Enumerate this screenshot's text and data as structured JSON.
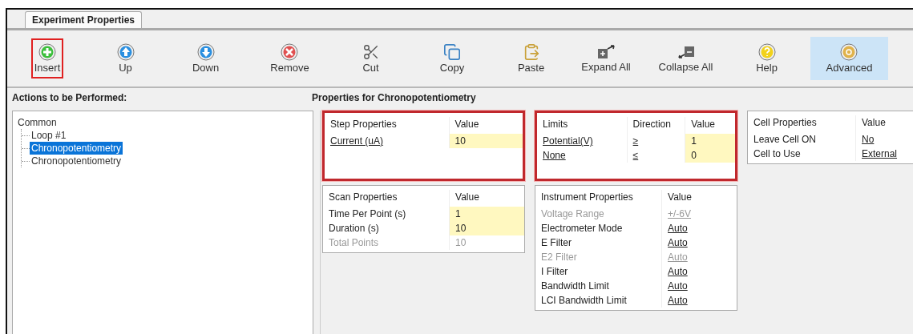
{
  "tabs": [
    {
      "label": "Experiment Properties",
      "selected": true
    }
  ],
  "toolbar": [
    {
      "label": "Insert",
      "kind": "insert",
      "selected": false,
      "annotated": true
    },
    {
      "label": "Up",
      "kind": "up",
      "selected": false,
      "annotated": false
    },
    {
      "label": "Down",
      "kind": "down",
      "selected": false,
      "annotated": false
    },
    {
      "label": "Remove",
      "kind": "remove",
      "selected": false,
      "annotated": false
    },
    {
      "label": "Cut",
      "kind": "cut",
      "selected": false,
      "annotated": false
    },
    {
      "label": "Copy",
      "kind": "copy",
      "selected": false,
      "annotated": false
    },
    {
      "label": "Paste",
      "kind": "paste",
      "selected": false,
      "annotated": false
    },
    {
      "label": "Expand All",
      "kind": "expand",
      "selected": false,
      "annotated": false
    },
    {
      "label": "Collapse All",
      "kind": "collapse",
      "selected": false,
      "annotated": false
    },
    {
      "label": "Help",
      "kind": "help",
      "selected": false,
      "annotated": false
    },
    {
      "label": "Advanced",
      "kind": "advanced",
      "selected": true,
      "annotated": false
    }
  ],
  "actions": {
    "title": "Actions to be Performed:",
    "tree": [
      {
        "label": "Common",
        "selected": false,
        "children": [
          {
            "label": "Loop #1",
            "selected": false
          },
          {
            "label": "Chronopotentiometry",
            "selected": true
          },
          {
            "label": "Chronopotentiometry",
            "selected": false
          }
        ]
      }
    ]
  },
  "properties": {
    "title": "Properties for Chronopotentiometry",
    "columns": [
      [
        {
          "annotated": true,
          "headers": [
            "Step Properties",
            "Value"
          ],
          "rows": [
            {
              "disabled": false,
              "cells": [
                {
                  "text": "Current (uA)",
                  "link": true,
                  "editable": false
                },
                {
                  "text": "10",
                  "link": false,
                  "editable": true
                }
              ]
            }
          ]
        },
        {
          "annotated": false,
          "headers": [
            "Scan Properties",
            "Value"
          ],
          "rows": [
            {
              "disabled": false,
              "cells": [
                {
                  "text": "Time Per Point (s)",
                  "link": false,
                  "editable": false
                },
                {
                  "text": "1",
                  "link": false,
                  "editable": true
                }
              ]
            },
            {
              "disabled": false,
              "cells": [
                {
                  "text": "Duration (s)",
                  "link": false,
                  "editable": false
                },
                {
                  "text": "10",
                  "link": false,
                  "editable": true
                }
              ]
            },
            {
              "disabled": true,
              "cells": [
                {
                  "text": "Total Points",
                  "link": false,
                  "editable": false
                },
                {
                  "text": "10",
                  "link": false,
                  "editable": false
                }
              ]
            }
          ]
        }
      ],
      [
        {
          "annotated": true,
          "headers": [
            "Limits",
            "Direction",
            "Value"
          ],
          "rows": [
            {
              "disabled": false,
              "cells": [
                {
                  "text": "Potential(V)",
                  "link": true,
                  "editable": false
                },
                {
                  "text": "≥",
                  "link": true,
                  "editable": false
                },
                {
                  "text": "1",
                  "link": false,
                  "editable": true
                }
              ]
            },
            {
              "disabled": false,
              "cells": [
                {
                  "text": "None",
                  "link": true,
                  "editable": false
                },
                {
                  "text": "≤",
                  "link": true,
                  "editable": false
                },
                {
                  "text": "0",
                  "link": false,
                  "editable": true
                }
              ]
            }
          ]
        },
        {
          "annotated": false,
          "headers": [
            "Instrument Properties",
            "Value"
          ],
          "rows": [
            {
              "disabled": true,
              "cells": [
                {
                  "text": "Voltage Range",
                  "link": false,
                  "editable": false
                },
                {
                  "text": "+/-6V",
                  "link": true,
                  "editable": false
                }
              ]
            },
            {
              "disabled": false,
              "cells": [
                {
                  "text": "Electrometer Mode",
                  "link": false,
                  "editable": false
                },
                {
                  "text": "Auto",
                  "link": true,
                  "editable": false
                }
              ]
            },
            {
              "disabled": false,
              "cells": [
                {
                  "text": "E Filter",
                  "link": false,
                  "editable": false
                },
                {
                  "text": "Auto",
                  "link": true,
                  "editable": false
                }
              ]
            },
            {
              "disabled": true,
              "cells": [
                {
                  "text": "E2 Filter",
                  "link": false,
                  "editable": false
                },
                {
                  "text": "Auto",
                  "link": true,
                  "editable": false
                }
              ]
            },
            {
              "disabled": false,
              "cells": [
                {
                  "text": "I Filter",
                  "link": false,
                  "editable": false
                },
                {
                  "text": "Auto",
                  "link": true,
                  "editable": false
                }
              ]
            },
            {
              "disabled": false,
              "cells": [
                {
                  "text": "Bandwidth Limit",
                  "link": false,
                  "editable": false
                },
                {
                  "text": "Auto",
                  "link": true,
                  "editable": false
                }
              ]
            },
            {
              "disabled": false,
              "cells": [
                {
                  "text": "LCI Bandwidth Limit",
                  "link": false,
                  "editable": false
                },
                {
                  "text": "Auto",
                  "link": true,
                  "editable": false
                }
              ]
            }
          ]
        }
      ],
      [
        {
          "annotated": false,
          "headers": [
            "Cell Properties",
            "Value"
          ],
          "rows": [
            {
              "disabled": false,
              "cells": [
                {
                  "text": "Leave Cell ON",
                  "link": false,
                  "editable": false
                },
                {
                  "text": "No",
                  "link": true,
                  "editable": false
                }
              ]
            },
            {
              "disabled": false,
              "cells": [
                {
                  "text": "Cell to Use",
                  "link": false,
                  "editable": false
                },
                {
                  "text": "External",
                  "link": true,
                  "editable": false
                }
              ]
            }
          ]
        }
      ]
    ]
  }
}
